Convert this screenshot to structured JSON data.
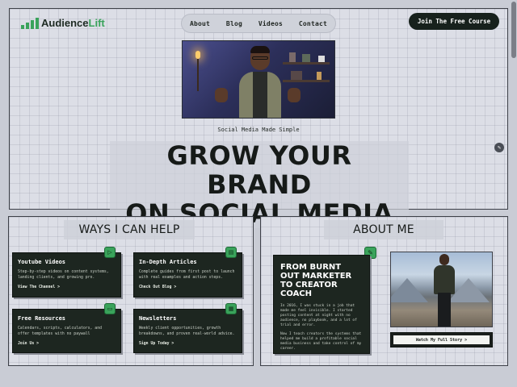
{
  "header": {
    "logo_text_dark": "Audience",
    "logo_text_accent": "Lift",
    "nav": [
      "About",
      "Blog",
      "Videos",
      "Contact"
    ],
    "cta_label": "Join The Free Course"
  },
  "hero": {
    "tagline": "Social Media Made Simple",
    "headline_line1": "GROW YOUR BRAND",
    "headline_line2": "ON SOCIAL MEDIA"
  },
  "ways": {
    "title": "WAYS I CAN HELP",
    "cards": [
      {
        "title": "Youtube Videos",
        "desc": "Step-by-step videos on content systems, landing clients, and growing pro.",
        "link": "View The Channel >",
        "icon": "play-icon",
        "glyph": "▷"
      },
      {
        "title": "In-Depth Articles",
        "desc": "Complete guides from first post to launch with real examples and action steps.",
        "link": "Check Out Blog >",
        "icon": "article-icon",
        "glyph": "▤"
      },
      {
        "title": "Free Resources",
        "desc": "Calendars, scripts, calculators, and offer templates with no paywall",
        "link": "Join Us >",
        "icon": "chat-icon",
        "glyph": "▭"
      },
      {
        "title": "Newsletters",
        "desc": "Weekly client opportunities, growth breakdowns, and proven real-world advice.",
        "link": "Sign Up Today >",
        "icon": "newsletter-icon",
        "glyph": "▦"
      }
    ]
  },
  "about": {
    "title": "ABOUT ME",
    "heading": "FROM BURNT OUT MARKETER TO CREATOR COACH",
    "para1": "In 2016, I was stuck in a job that made me feel invisible. I started posting content at night with no audience, no playbook, and a lot of trial and error.",
    "para2": "Now I teach creators the systems that helped me build a profitable social media business and take control of my career.",
    "button_label": "Watch My Full Story >",
    "badge_icon": "pencil-icon"
  },
  "colors": {
    "accent": "#3aa35b",
    "dark": "#1d2620",
    "background": "#dcdee6"
  }
}
